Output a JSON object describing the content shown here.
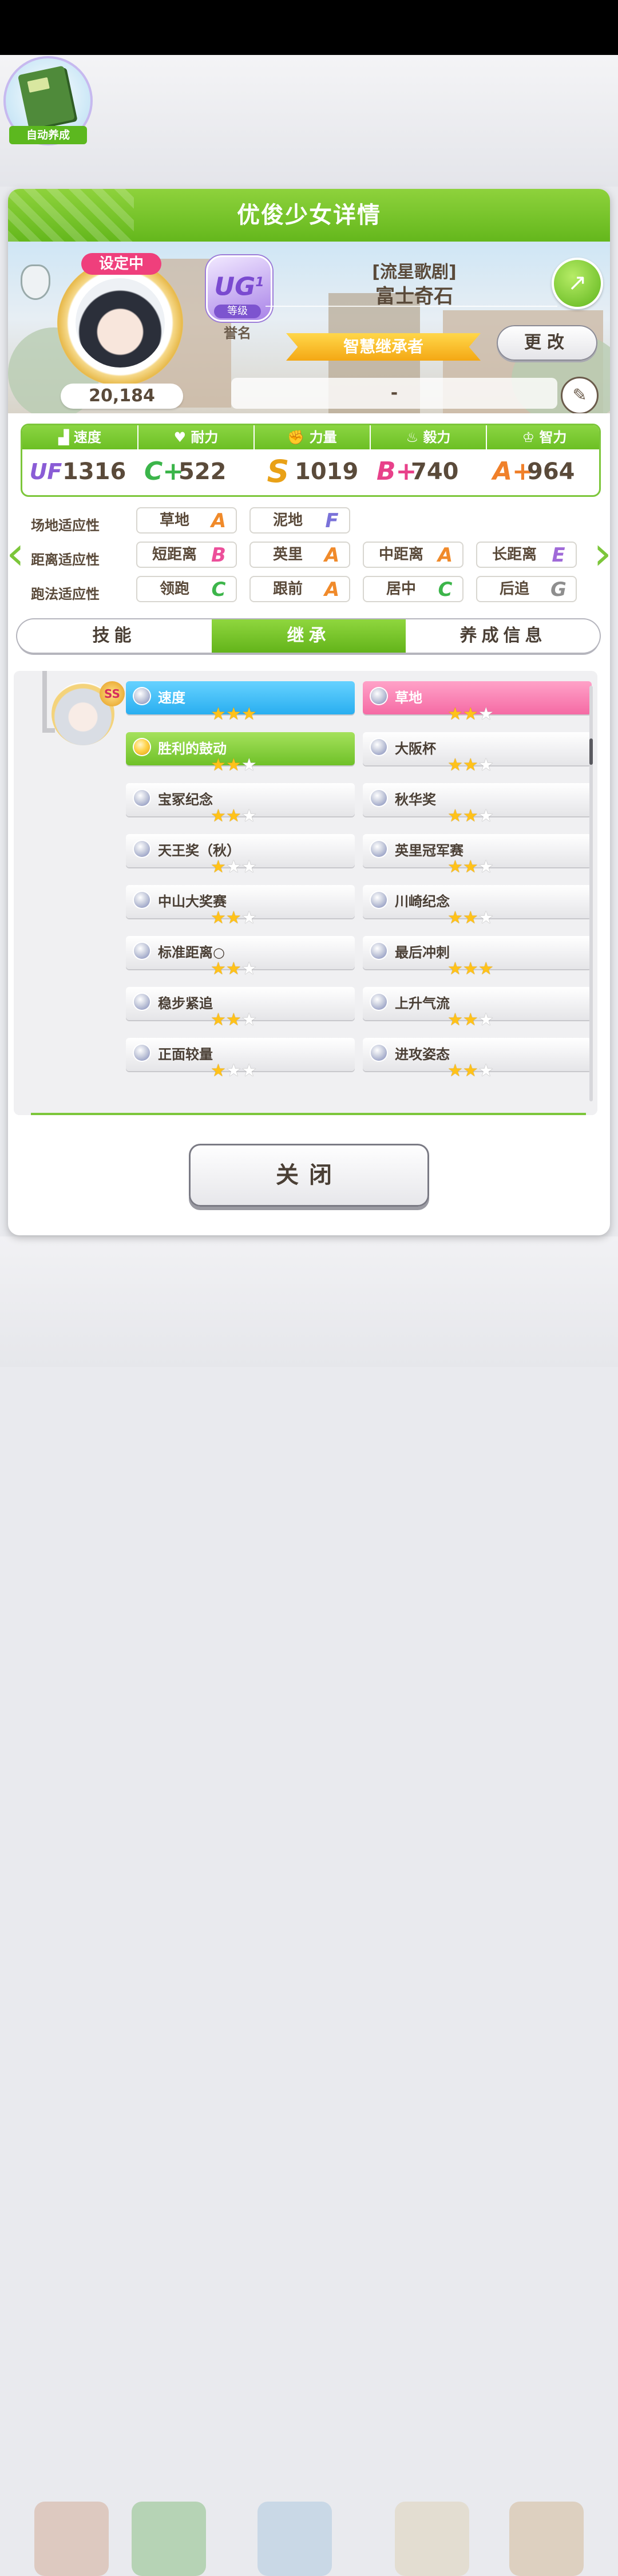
{
  "auto_train": {
    "label": "自动养成"
  },
  "panel": {
    "title": "优俊少女详情"
  },
  "profile": {
    "setting_badge": "设定中",
    "fans": "20,184",
    "rank_grade": "UG",
    "rank_grade_sub": "1",
    "rank_label": "等级",
    "rank_note": "誉名",
    "epithet": "[流星歌剧]",
    "name": "富士奇石",
    "title_ribbon": "智慧继承者",
    "change_button": "更改",
    "comment": "-"
  },
  "stats": [
    {
      "name": "速度",
      "grade": "UF",
      "value": "1316",
      "icon": "shoe-icon",
      "color": "#8a5cd6"
    },
    {
      "name": "耐力",
      "grade": "C+",
      "value": "522",
      "icon": "heart-icon",
      "color": "#3bb54a"
    },
    {
      "name": "力量",
      "grade": "S",
      "value": "1019",
      "icon": "muscle-icon",
      "color": "#e9a117"
    },
    {
      "name": "毅力",
      "grade": "B+",
      "value": "740",
      "icon": "flame-icon",
      "color": "#e8418a"
    },
    {
      "name": "智力",
      "grade": "A+",
      "value": "964",
      "icon": "mortarboard-icon",
      "color": "#f0802a"
    }
  ],
  "aptitude": {
    "track": {
      "label": "场地适应性",
      "items": [
        {
          "name": "草地",
          "grade": "A"
        },
        {
          "name": "泥地",
          "grade": "F"
        }
      ]
    },
    "distance": {
      "label": "距离适应性",
      "items": [
        {
          "name": "短距离",
          "grade": "B"
        },
        {
          "name": "英里",
          "grade": "A"
        },
        {
          "name": "中距离",
          "grade": "A"
        },
        {
          "name": "长距离",
          "grade": "E"
        }
      ]
    },
    "style": {
      "label": "跑法适应性",
      "items": [
        {
          "name": "领跑",
          "grade": "C"
        },
        {
          "name": "跟前",
          "grade": "A"
        },
        {
          "name": "居中",
          "grade": "C"
        },
        {
          "name": "后追",
          "grade": "G"
        }
      ]
    }
  },
  "grade_colors": {
    "A": "#f08a2a",
    "B": "#ec4f9a",
    "C": "#3cb54a",
    "E": "#a06ad8",
    "F": "#7a72d9",
    "G": "#8e8e8e"
  },
  "tabs": [
    {
      "label": "技能"
    },
    {
      "label": "继承",
      "active": true
    },
    {
      "label": "养成信息"
    }
  ],
  "inherit": {
    "parent_badge": "SS",
    "factors": [
      {
        "name": "速度",
        "stars": 3,
        "kind": "blue"
      },
      {
        "name": "草地",
        "stars": 2,
        "kind": "pink"
      },
      {
        "name": "胜利的鼓动",
        "stars": 2,
        "kind": "green"
      },
      {
        "name": "大阪杯",
        "stars": 2,
        "kind": "white"
      },
      {
        "name": "宝冢纪念",
        "stars": 2,
        "kind": "white"
      },
      {
        "name": "秋华奖",
        "stars": 2,
        "kind": "white"
      },
      {
        "name": "天王奖（秋）",
        "stars": 1,
        "kind": "white"
      },
      {
        "name": "英里冠军赛",
        "stars": 2,
        "kind": "white"
      },
      {
        "name": "中山大奖赛",
        "stars": 2,
        "kind": "white"
      },
      {
        "name": "川崎纪念",
        "stars": 2,
        "kind": "white"
      },
      {
        "name": "标准距离○",
        "stars": 2,
        "kind": "white"
      },
      {
        "name": "最后冲刺",
        "stars": 3,
        "kind": "white"
      },
      {
        "name": "稳步紧追",
        "stars": 2,
        "kind": "white"
      },
      {
        "name": "上升气流",
        "stars": 2,
        "kind": "white"
      },
      {
        "name": "正面较量",
        "stars": 1,
        "kind": "white"
      },
      {
        "name": "进攻姿态",
        "stars": 2,
        "kind": "white"
      }
    ]
  },
  "close_button": "关闭"
}
